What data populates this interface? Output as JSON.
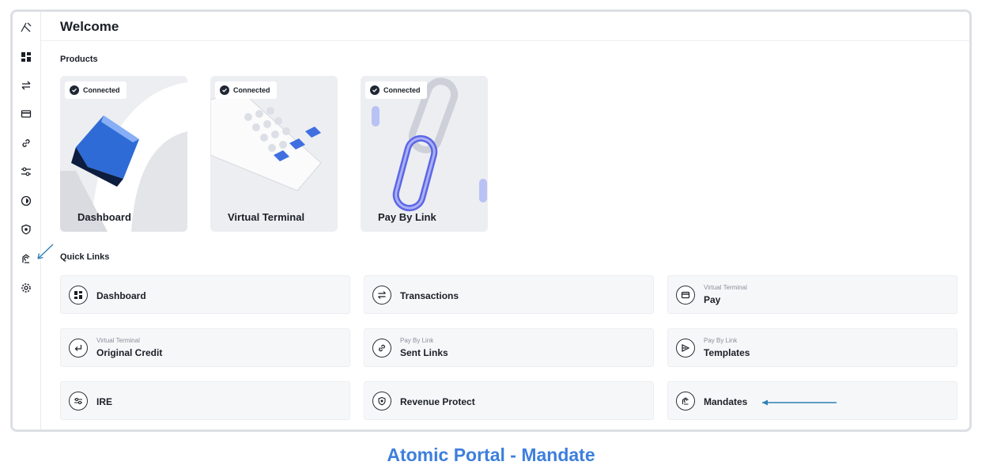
{
  "header": {
    "title": "Welcome"
  },
  "sidebar": {
    "logo": "atomic-logo-icon",
    "items": [
      {
        "icon": "dashboard-icon"
      },
      {
        "icon": "transactions-icon"
      },
      {
        "icon": "card-icon"
      },
      {
        "icon": "link-icon"
      },
      {
        "icon": "sliders-icon"
      },
      {
        "icon": "globe-icon"
      },
      {
        "icon": "shield-icon"
      },
      {
        "icon": "mandates-icon"
      },
      {
        "icon": "settings-icon"
      }
    ]
  },
  "products": {
    "label": "Products",
    "cards": [
      {
        "badge": "Connected",
        "title": "Dashboard"
      },
      {
        "badge": "Connected",
        "title": "Virtual Terminal"
      },
      {
        "badge": "Connected",
        "title": "Pay By Link"
      }
    ]
  },
  "quick_links": {
    "label": "Quick Links",
    "items": [
      {
        "title": "Dashboard",
        "sub": "",
        "icon": "dashboard-icon"
      },
      {
        "title": "Transactions",
        "sub": "",
        "icon": "transactions-icon"
      },
      {
        "title": "Pay",
        "sub": "Virtual Terminal",
        "icon": "card-icon"
      },
      {
        "title": "Original Credit",
        "sub": "Virtual Terminal",
        "icon": "return-icon"
      },
      {
        "title": "Sent Links",
        "sub": "Pay By Link",
        "icon": "link-icon"
      },
      {
        "title": "Templates",
        "sub": "Pay By Link",
        "icon": "template-icon"
      },
      {
        "title": "IRE",
        "sub": "",
        "icon": "sliders-icon"
      },
      {
        "title": "Revenue Protect",
        "sub": "",
        "icon": "shield-icon"
      },
      {
        "title": "Mandates",
        "sub": "",
        "icon": "mandates-icon"
      }
    ]
  },
  "caption": "Atomic Portal - Mandate",
  "colors": {
    "accent": "#3d7fdc",
    "card_bg": "#eceef1",
    "annotation_arrow": "#2f7fb5"
  }
}
